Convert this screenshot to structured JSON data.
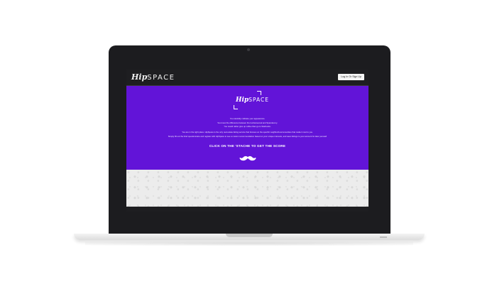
{
  "site": {
    "logo_hip": "Hip",
    "logo_space": "SPACE",
    "login_label": "Log In Or Sign Up"
  },
  "hero": {
    "logo_hip": "Hip",
    "logo_space": "SPACE",
    "lines": [
      "You carefully cultivate your appearance.",
      "You know the difference between the lumbersexual and Spandexury.",
      "You would rather give up coffee than go to Starbucks.",
      "You are in the right place. HipSpace is the only real estate listing service that focuses on the specific neighborhood amenities that matter most to you.",
      "Simply fill out the brief questionnaire and register with HipSpace to see a custom recommendation based on your unique interests, and save listings to your account for later perusal!"
    ],
    "cta": "CLICK ON THE 'STACHE TO GET THE SCORE"
  },
  "colors": {
    "hero_bg": "#6214d8",
    "header_bg": "#1e1e21",
    "pattern_bg": "#ececec"
  },
  "icons": {
    "hero_action": "mustache-icon"
  }
}
